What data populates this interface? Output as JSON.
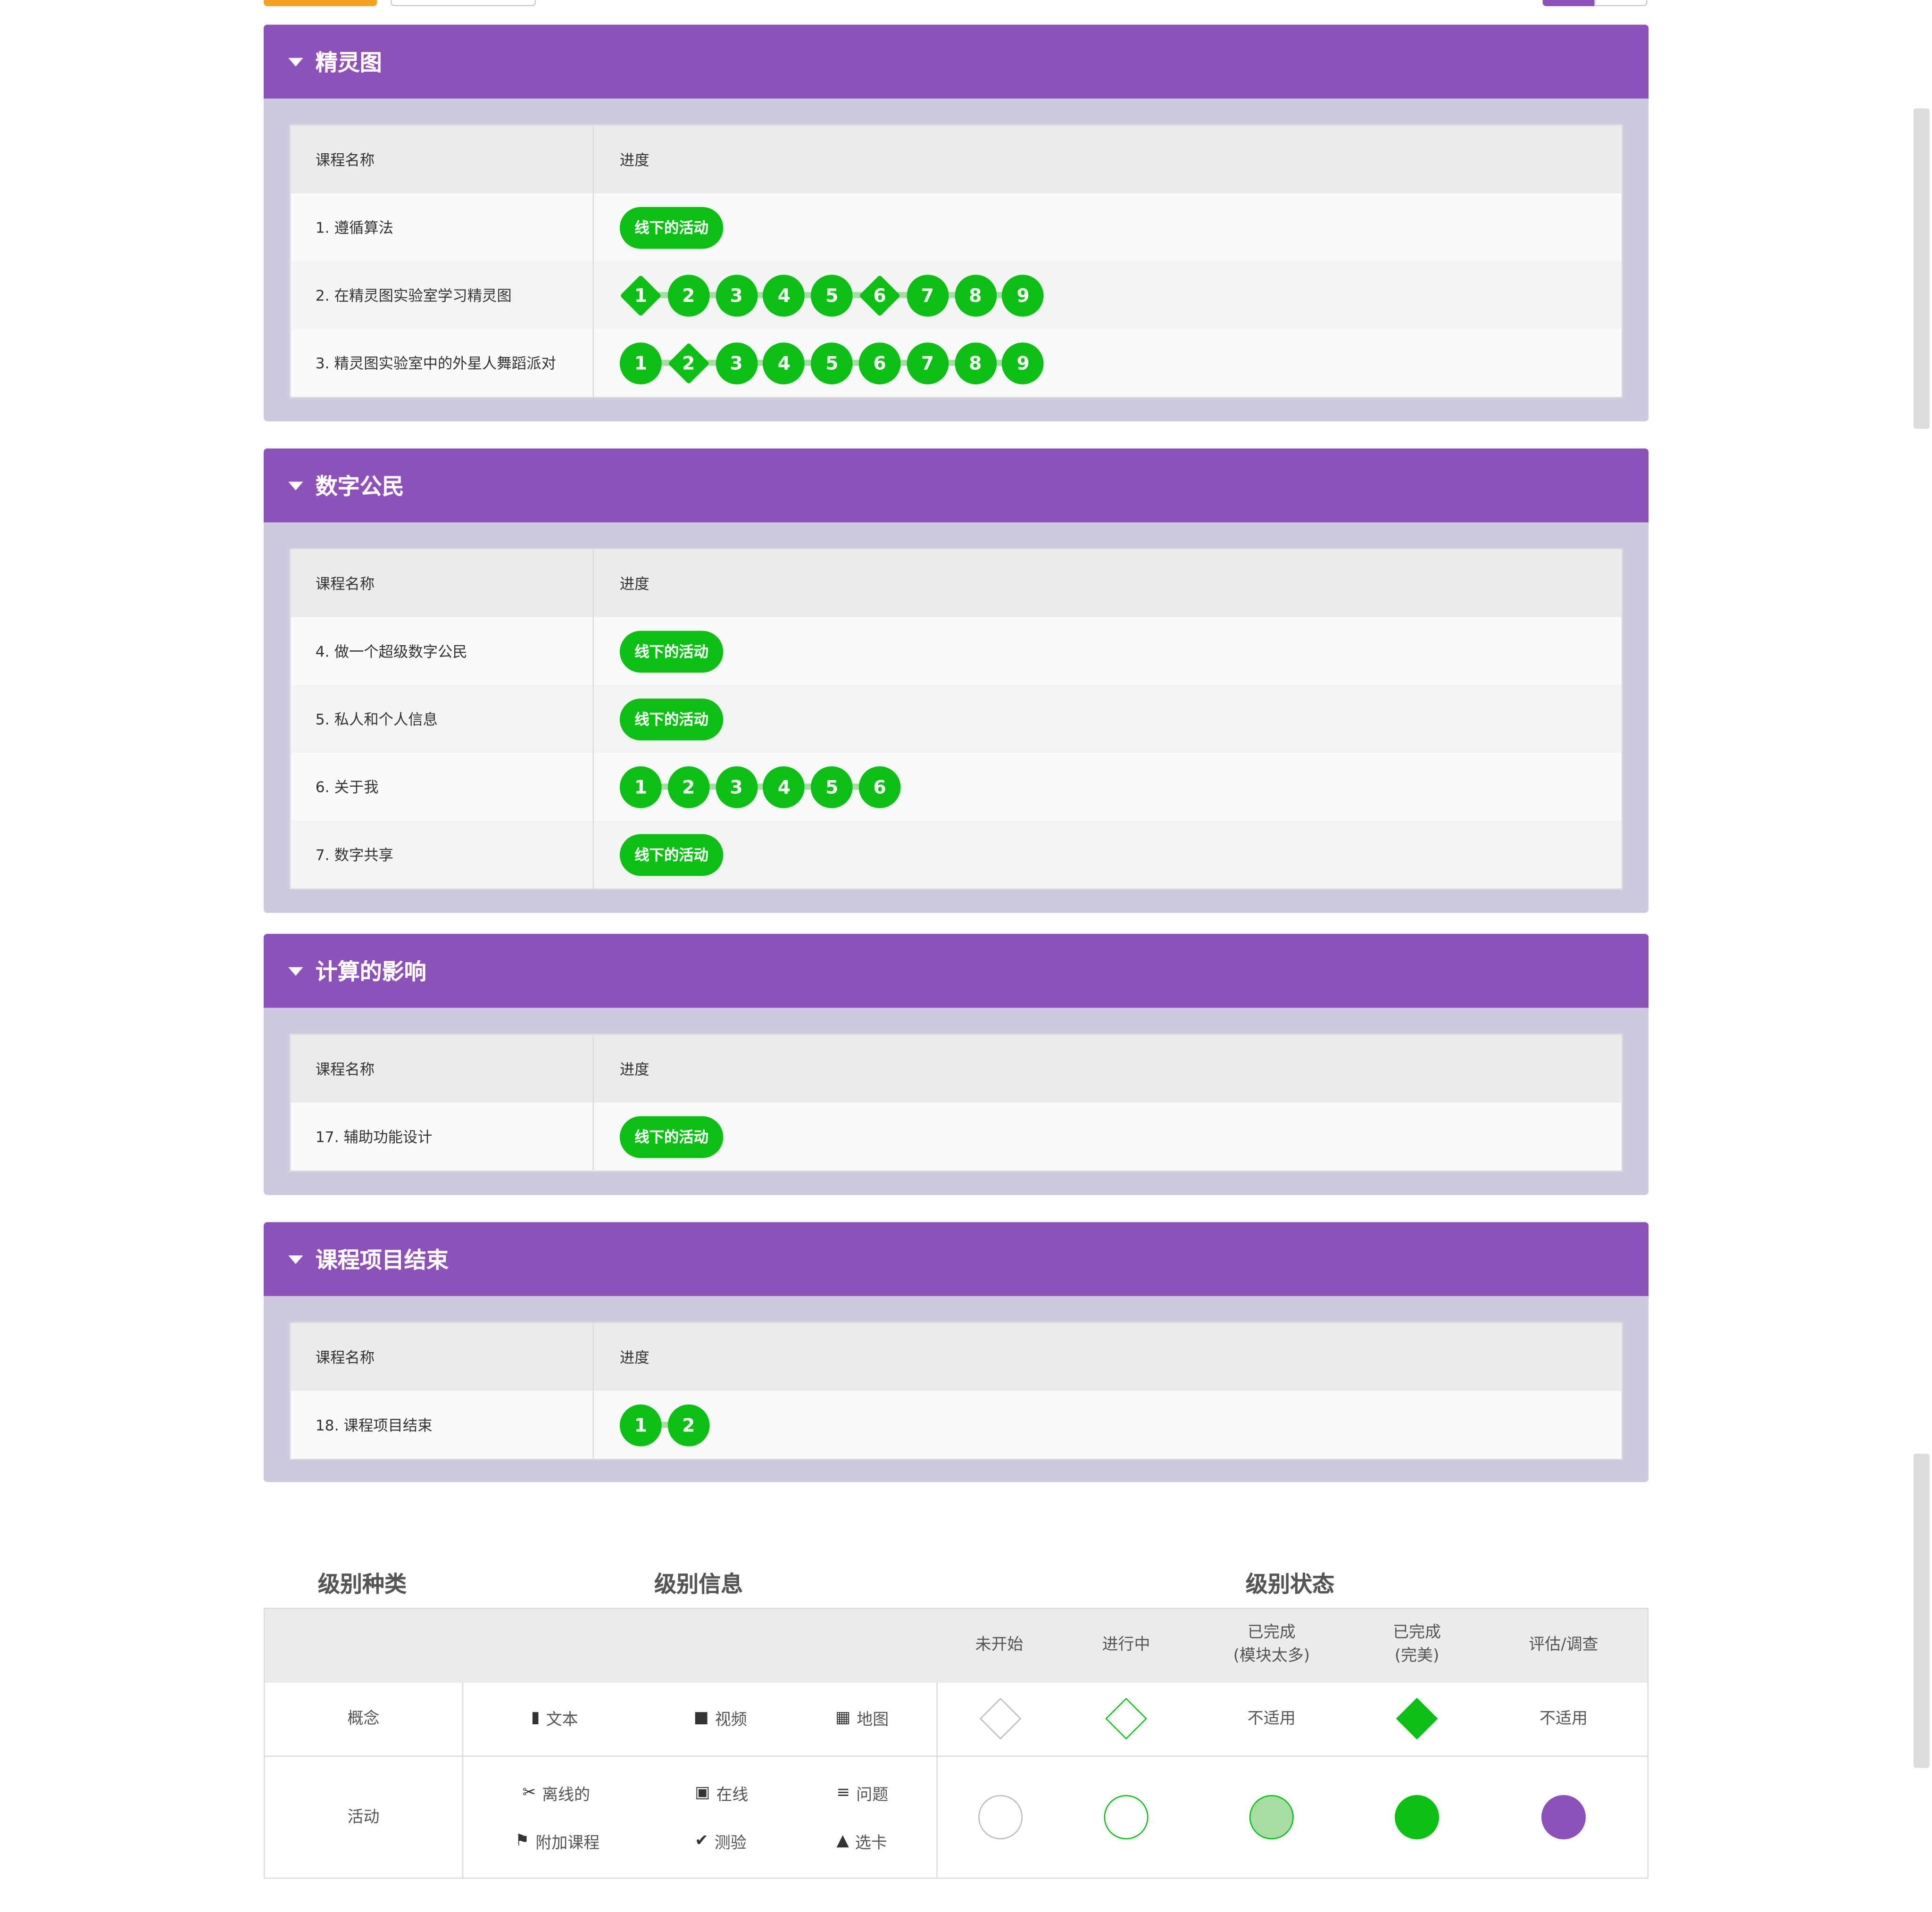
{
  "units": [
    {
      "title": "精灵图",
      "header": {
        "name": "课程名称",
        "progress": "进度"
      },
      "lessons": [
        {
          "name": "1. 遵循算法",
          "pill": "线下的活动"
        },
        {
          "name": "2. 在精灵图实验室学习精灵图",
          "levels": [
            "1",
            "2",
            "3",
            "4",
            "5",
            "6",
            "7",
            "8",
            "9"
          ],
          "diamonds": [
            0,
            5
          ]
        },
        {
          "name": "3. 精灵图实验室中的外星人舞蹈派对",
          "levels": [
            "1",
            "2",
            "3",
            "4",
            "5",
            "6",
            "7",
            "8",
            "9"
          ],
          "diamonds": [
            1
          ]
        }
      ]
    },
    {
      "title": "数字公民",
      "header": {
        "name": "课程名称",
        "progress": "进度"
      },
      "lessons": [
        {
          "name": "4. 做一个超级数字公民",
          "pill": "线下的活动"
        },
        {
          "name": "5. 私人和个人信息",
          "pill": "线下的活动"
        },
        {
          "name": "6. 关于我",
          "levels": [
            "1",
            "2",
            "3",
            "4",
            "5",
            "6"
          ],
          "diamonds": []
        },
        {
          "name": "7. 数字共享",
          "pill": "线下的活动"
        }
      ]
    },
    {
      "title": "计算的影响",
      "header": {
        "name": "课程名称",
        "progress": "进度"
      },
      "lessons": [
        {
          "name": "17. 辅助功能设计",
          "pill": "线下的活动"
        }
      ]
    },
    {
      "title": "课程项目结束",
      "header": {
        "name": "课程名称",
        "progress": "进度"
      },
      "lessons": [
        {
          "name": "18. 课程项目结束",
          "levels": [
            "1",
            "2"
          ],
          "diamonds": []
        }
      ]
    }
  ],
  "legend": {
    "titles": {
      "kind": "级别种类",
      "info": "级别信息",
      "status": "级别状态"
    },
    "status_cols": {
      "not_started": "未开始",
      "in_progress": "进行中",
      "completed_too_many": "已完成\n(模块太多)",
      "completed_perfect": "已完成\n(完美)",
      "assessment": "评估/调查"
    },
    "rows": {
      "concept": {
        "label": "概念",
        "items": {
          "text": "文本",
          "video": "视频",
          "map": "地图"
        },
        "na": "不适用",
        "na2": "不适用"
      },
      "activity": {
        "label": "活动",
        "items": {
          "offline": "离线的",
          "online": "在线",
          "question": "问题",
          "bonus": "附加课程",
          "quiz": "测验",
          "tabs": "选卡"
        }
      }
    }
  },
  "colors": {
    "purple": "#8c52ba",
    "green": "#0bbf15",
    "light_green": "#a6dda4",
    "orange": "#f3a11f"
  }
}
